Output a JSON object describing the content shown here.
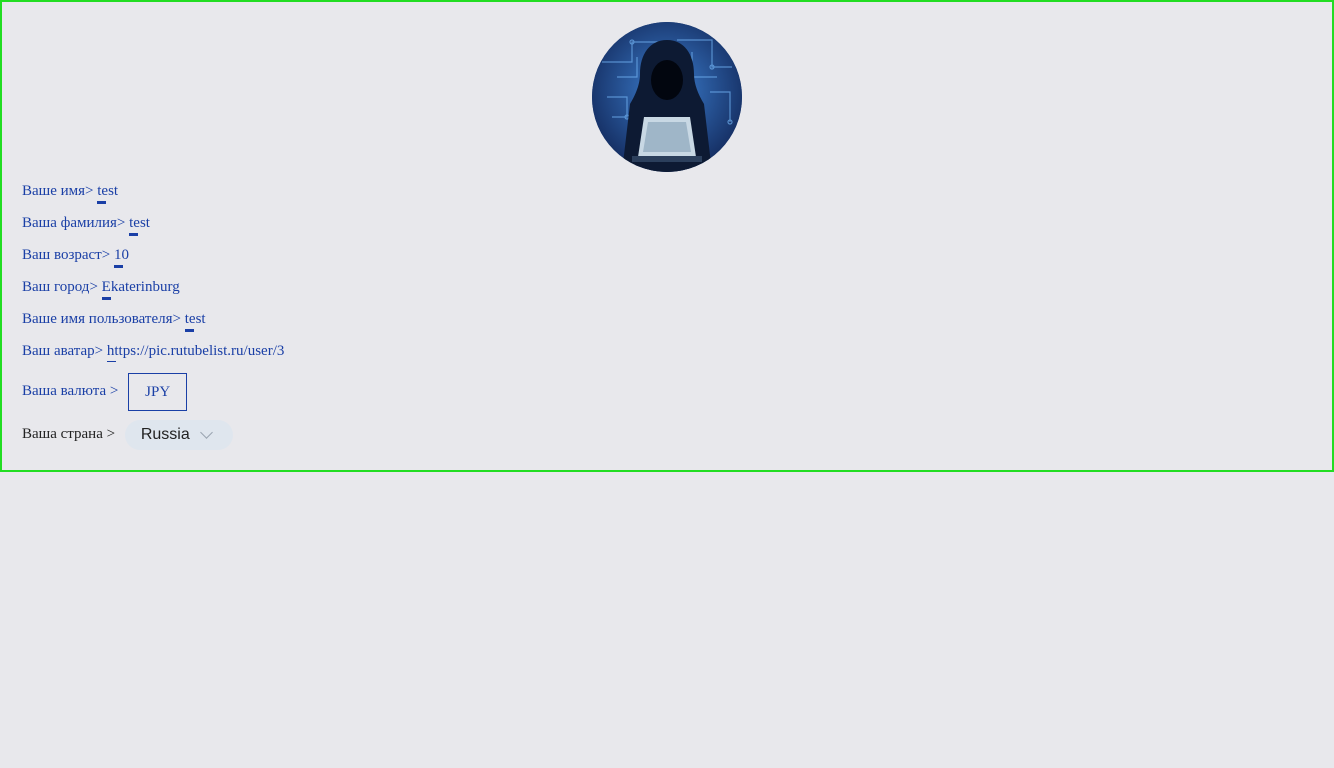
{
  "avatar": {
    "alt": "hacker-avatar"
  },
  "fields": {
    "name": {
      "label": "Ваше имя>",
      "value": "test"
    },
    "surname": {
      "label": "Ваша фамилия>",
      "value": "test"
    },
    "age": {
      "label": "Ваш возраст>",
      "value": "10"
    },
    "city": {
      "label": "Ваш город>",
      "value": "Ekaterinburg"
    },
    "username": {
      "label": "Ваше имя пользователя>",
      "value": "test"
    },
    "avatar_url": {
      "label": "Ваш аватар>",
      "value": "https://pic.rutubelist.ru/user/3"
    }
  },
  "currency": {
    "label": "Ваша валюта >",
    "value": "JPY"
  },
  "country": {
    "label": "Ваша страна >",
    "value": "Russia"
  },
  "colors": {
    "accent": "#1a3fa6",
    "panel_border": "#22dd22",
    "background": "#e8e8ec"
  }
}
